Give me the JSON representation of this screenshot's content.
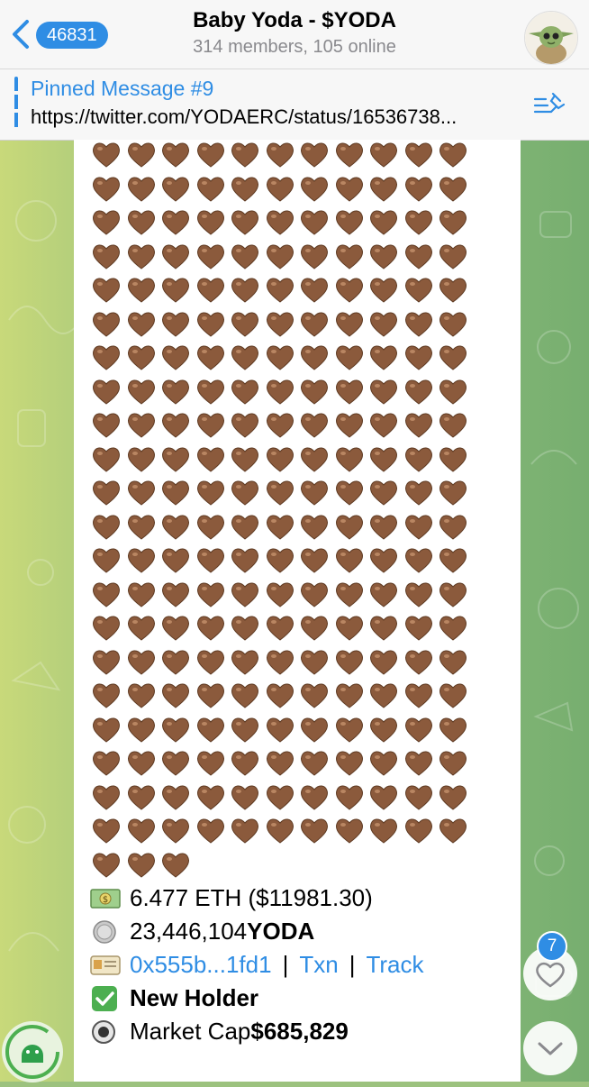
{
  "header": {
    "back_count": "46831",
    "title": "Baby Yoda - $YODA",
    "subtitle": "314 members, 105 online"
  },
  "pinned": {
    "title": "Pinned Message #9",
    "text": "https://twitter.com/YODAERC/status/16536738..."
  },
  "message": {
    "heart_count": 234,
    "line1": "6.477 ETH ($11981.30)",
    "line2_amount": "23,446,104 ",
    "line2_token": "YODA",
    "line3_address": "0x555b...1fd1",
    "line3_sep1": "|",
    "line3_txn": "Txn",
    "line3_sep2": "|",
    "line3_track": "Track",
    "line4": "New Holder",
    "line5_label": "Market Cap ",
    "line5_value": "$685,829"
  },
  "reaction_count": "7",
  "colors": {
    "accent": "#2f8de4",
    "heart": "#8b5a3c",
    "check": "#4caf50"
  }
}
